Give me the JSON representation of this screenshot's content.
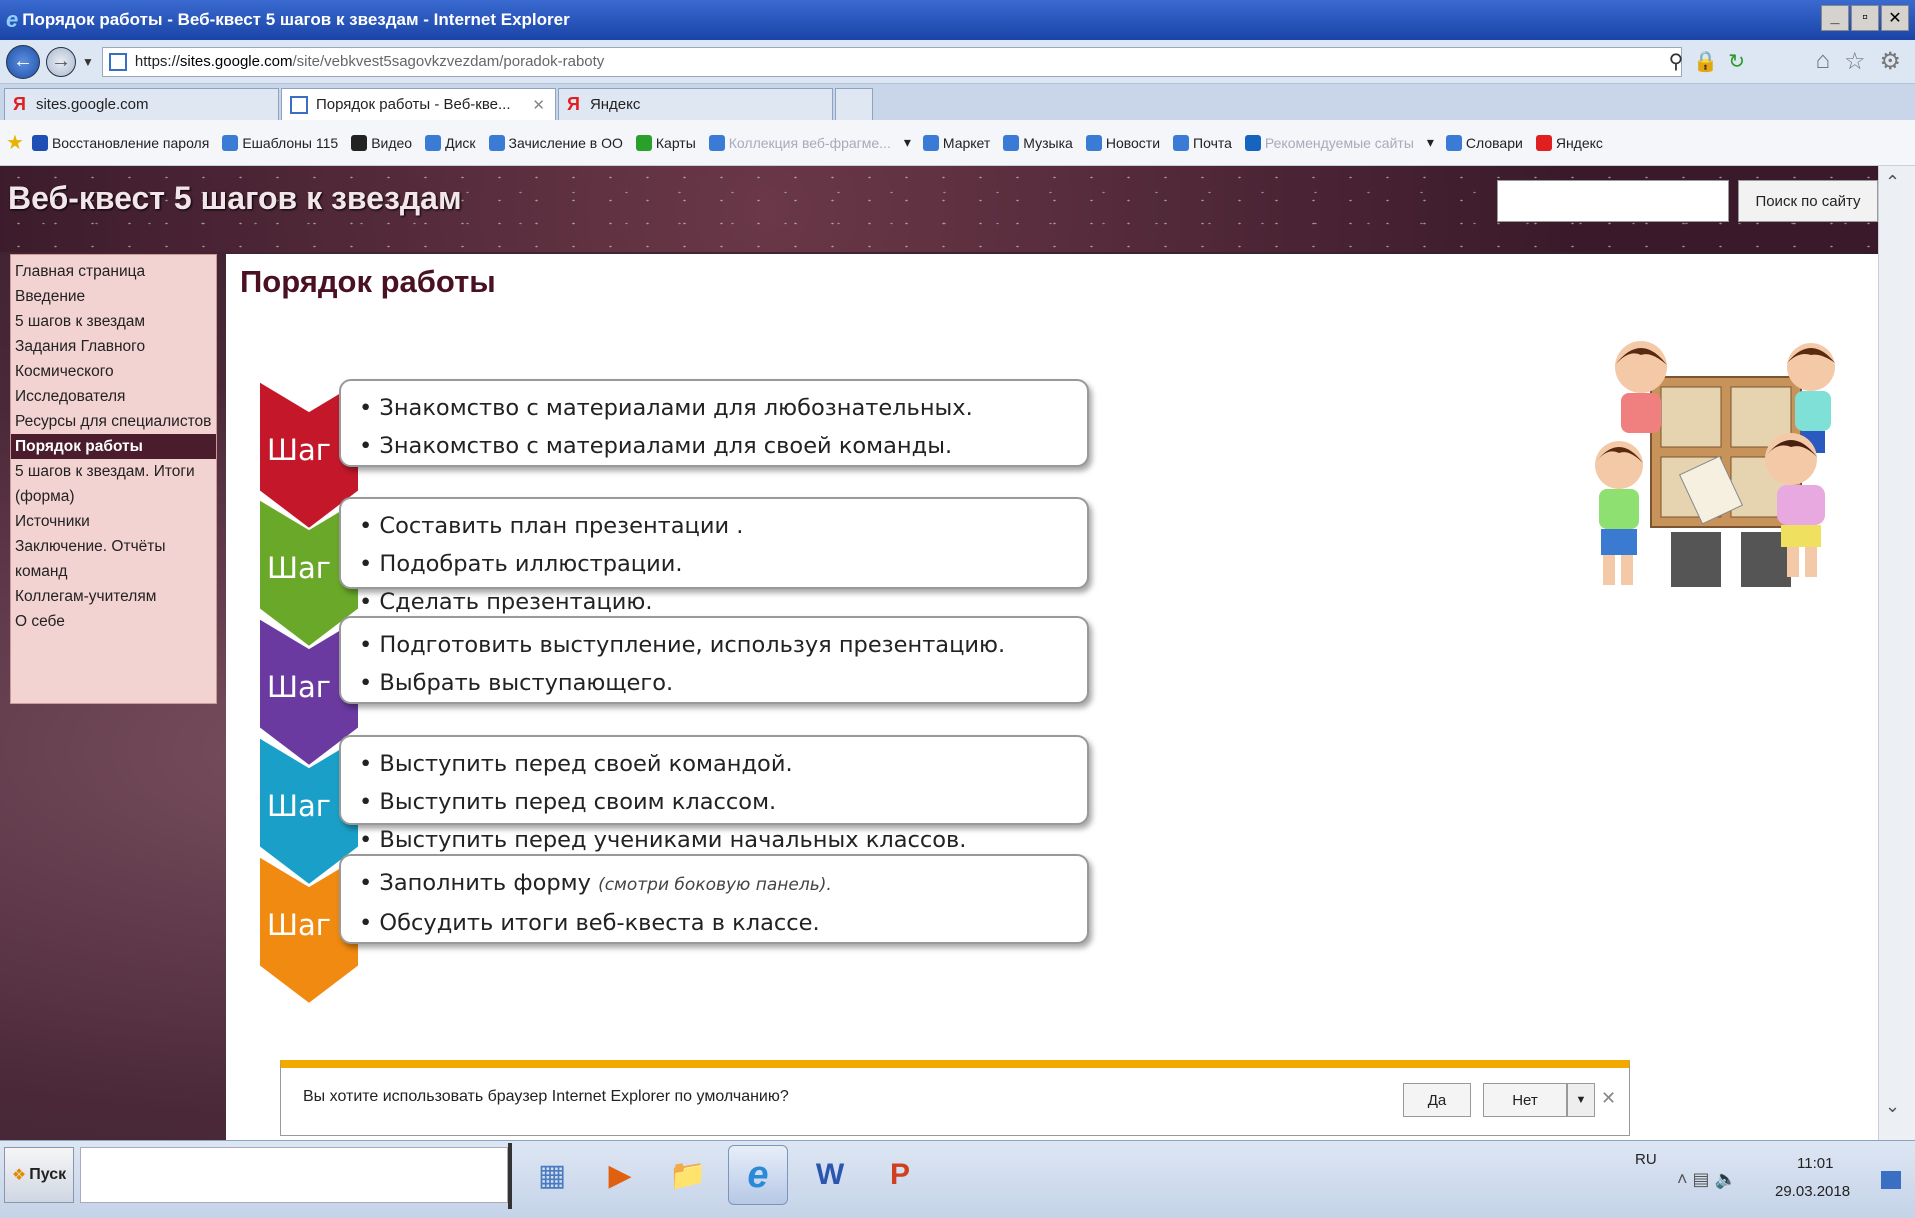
{
  "window": {
    "title": "Порядок работы - Веб-квест 5 шагов к звездам - Internet Explorer",
    "controls": [
      "_",
      "▫",
      "✕"
    ]
  },
  "address": {
    "scheme": "https://",
    "host": "sites.google.com",
    "path": "/site/vebkvest5sagovkzvezdam/poradok-raboty"
  },
  "tabs": [
    {
      "label": "sites.google.com",
      "icon": "yandex-icon"
    },
    {
      "label": "Порядок работы - Веб-кве...",
      "icon": "page-icon",
      "close": "✕"
    },
    {
      "label": "Яндекс",
      "icon": "yandex-icon"
    }
  ],
  "favorites": [
    {
      "label": "Восстановление пароля",
      "dim": false,
      "color": "#1f4fb5"
    },
    {
      "label": "Ешаблоны 115",
      "dim": false,
      "color": "#3a7bd5"
    },
    {
      "label": "Видео",
      "dim": false,
      "color": "#222"
    },
    {
      "label": "Диск",
      "dim": false,
      "color": "#3a7bd5"
    },
    {
      "label": "Зачисление в ОО",
      "dim": false,
      "color": "#3a7bd5"
    },
    {
      "label": "Карты",
      "dim": false,
      "color": "#2aa02a"
    },
    {
      "label": "Коллекция веб-фрагме...",
      "dim": true,
      "color": "#3a7bd5"
    },
    {
      "label": "Маркет",
      "dim": false,
      "color": "#3a7bd5"
    },
    {
      "label": "Музыка",
      "dim": false,
      "color": "#3a7bd5"
    },
    {
      "label": "Новости",
      "dim": false,
      "color": "#3a7bd5"
    },
    {
      "label": "Почта",
      "dim": false,
      "color": "#3a7bd5"
    },
    {
      "label": "Рекомендуемые сайты",
      "dim": true,
      "color": "#1565c0"
    },
    {
      "label": "Словари",
      "dim": false,
      "color": "#3a7bd5"
    },
    {
      "label": "Яндекс",
      "dim": false,
      "color": "#e02020"
    }
  ],
  "site": {
    "title": "Веб-квест 5 шагов к звездам",
    "search_button": "Поиск по сайту",
    "nav": [
      {
        "label": "Главная страница",
        "active": false
      },
      {
        "label": "Введение",
        "active": false
      },
      {
        "label": "5 шагов к звездам",
        "active": false
      },
      {
        "label": "Задания Главного Космического Исследователя",
        "active": false
      },
      {
        "label": "Ресурсы для специалистов",
        "active": false
      },
      {
        "label": "Порядок работы",
        "active": true
      },
      {
        "label": "5 шагов к звездам. Итоги (форма)",
        "active": false
      },
      {
        "label": "Источники",
        "active": false
      },
      {
        "label": "Заключение. Отчёты команд",
        "active": false
      },
      {
        "label": "Коллегам-учителям",
        "active": false
      },
      {
        "label": "О себе",
        "active": false
      }
    ],
    "page_title": "Порядок работы",
    "steps": [
      {
        "label": "Шаг 1",
        "color": "#c4182a",
        "items": [
          "• Знакомство с материалами для любознательных.",
          "• Знакомство с материалами для своей команды."
        ]
      },
      {
        "label": "Шаг 2",
        "color": "#6aa82a",
        "items": [
          "• Составить план презентации .",
          "• Подобрать иллюстрации.",
          "• Сделать презентацию."
        ]
      },
      {
        "label": "Шаг 3",
        "color": "#6a3aa0",
        "items": [
          "• Подготовить выступление, используя презентацию.",
          "• Выбрать выступающего."
        ]
      },
      {
        "label": "Шаг 4",
        "color": "#1aa0c8",
        "items": [
          "• Выступить перед своей командой.",
          "• Выступить перед своим классом.",
          "• Выступить перед учениками начальных классов."
        ]
      },
      {
        "label": "Шаг 5",
        "color": "#f08a10",
        "items": [
          "• Заполнить форму",
          "• Обсудить итоги веб-квеста в классе."
        ],
        "note": "(смотри боковую панель)."
      }
    ]
  },
  "notification": {
    "message": "Вы хотите использовать браузер Internet Explorer по умолчанию?",
    "yes": "Да",
    "no": "Нет"
  },
  "taskbar": {
    "start": "Пуск",
    "lang": "RU",
    "time": "11:01",
    "date": "29.03.2018"
  }
}
